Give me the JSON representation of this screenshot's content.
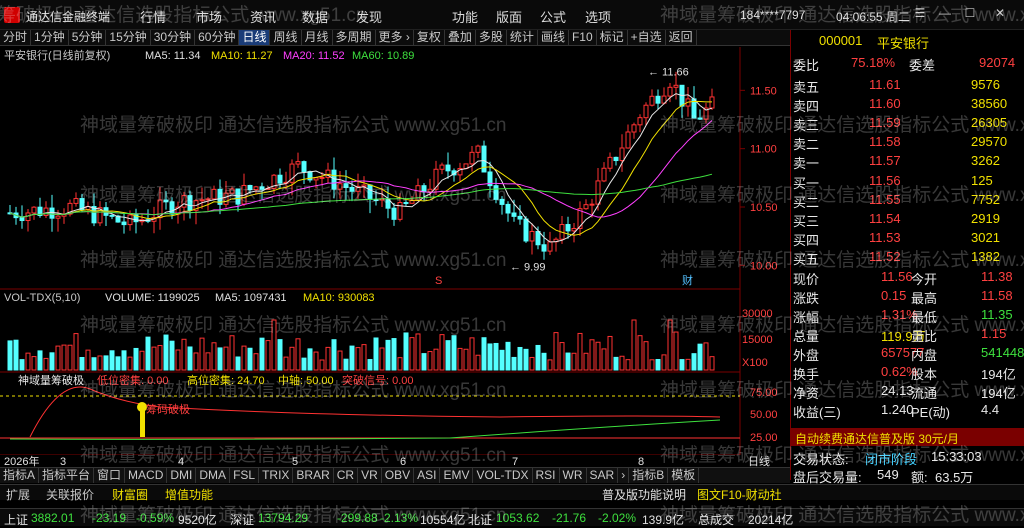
{
  "window": {
    "app_title": "通达信金融终端",
    "menus": [
      "行情",
      "市场",
      "资讯",
      "数据",
      "发现",
      "功能",
      "版面",
      "公式",
      "选项"
    ],
    "account": "184****7797",
    "clock": "04:06:55 周二"
  },
  "tabs": [
    "分时",
    "1分钟",
    "5分钟",
    "15分钟",
    "30分钟",
    "60分钟",
    "日线",
    "周线",
    "月线",
    "多周期",
    "更多 ›",
    "复权",
    "叠加",
    "多股",
    "统计",
    "画线",
    "F10",
    "标记",
    "+自选",
    "返回"
  ],
  "active_tab": "日线",
  "kline": {
    "header": "平安银行(日线前复权)",
    "ma5": "MA5: 11.34",
    "ma10": "MA10: 11.27",
    "ma20": "MA20: 11.52",
    "ma60": "MA60: 10.89",
    "axis": [
      "11.50",
      "11.00",
      "10.50",
      "10.00"
    ],
    "high_mark": "11.66",
    "low_mark": "9.99",
    "marker_s": "S",
    "marker_cai": "财"
  },
  "volume": {
    "header": "VOL-TDX(5,10)",
    "vol": "VOLUME: 1199025",
    "ma5": "MA5: 1097431",
    "ma10": "MA10: 930083",
    "axis": [
      "30000",
      "15000",
      "X100"
    ]
  },
  "indicator": {
    "header": "神域量筹破极",
    "t1": "低位密集: 0.00",
    "t2": "高位密集: 24.70",
    "t3": "中轴: 50.00",
    "t4": "突破信号: 0.00",
    "axis": [
      "75.00",
      "50.00",
      "25.00"
    ],
    "tag": "筹码破极"
  },
  "timeline": {
    "year": "2026年",
    "months": [
      "3",
      "4",
      "5",
      "6",
      "7",
      "8"
    ],
    "right": "日线"
  },
  "indicator_tabs": [
    "指标A",
    "指标平台",
    "窗口",
    "MACD",
    "DMI",
    "DMA",
    "FSL",
    "TRIX",
    "BRAR",
    "CR",
    "VR",
    "OBV",
    "ASI",
    "EMV",
    "VOL-TDX",
    "RSI",
    "WR",
    "SAR",
    "›",
    "指标B",
    "模板"
  ],
  "footer2": {
    "items": [
      "扩展",
      "关联报价",
      "财富圈",
      "增值功能"
    ],
    "news": "普及版功能说明",
    "extra": "图文F10-财动社"
  },
  "status": {
    "sh_label": "上证",
    "sh_val": "3882.01",
    "sh_chg": "-23.19",
    "sh_pct": "-0.59%",
    "sh_amt": "9520亿",
    "sz_label": "深证",
    "sz_val": "13794.29",
    "sz_chg": "-299.88",
    "sz_pct": "-2.13%",
    "sz_amt": "10554亿",
    "bz_label": "北证",
    "bz_val": "1053.62",
    "bz_chg": "-21.76",
    "bz_pct": "-2.02%",
    "bz_amt": "139.9亿",
    "total": "总成交",
    "total_val": "20214亿"
  },
  "stock": {
    "code": "000001",
    "name": "平安银行",
    "top_label": "委比",
    "top_pct": "75.18%",
    "top_diff_label": "委差",
    "top_diff": "92074",
    "asks": [
      {
        "l": "卖五",
        "p": "11.61",
        "v": "9576"
      },
      {
        "l": "卖四",
        "p": "11.60",
        "v": "38560"
      },
      {
        "l": "卖三",
        "p": "11.59",
        "v": "26305"
      },
      {
        "l": "卖二",
        "p": "11.58",
        "v": "29570"
      },
      {
        "l": "卖一",
        "p": "11.57",
        "v": "3262"
      }
    ],
    "bids": [
      {
        "l": "买一",
        "p": "11.56",
        "v": "125"
      },
      {
        "l": "买二",
        "p": "11.55",
        "v": "7752"
      },
      {
        "l": "买三",
        "p": "11.54",
        "v": "2919"
      },
      {
        "l": "买四",
        "p": "11.53",
        "v": "3021"
      },
      {
        "l": "买五",
        "p": "11.52",
        "v": "1382"
      }
    ],
    "stats": [
      {
        "a": "现价",
        "av": "11.56",
        "b": "今开",
        "bv": "11.38"
      },
      {
        "a": "涨跌",
        "av": "0.15",
        "b": "最高",
        "bv": "11.58"
      },
      {
        "a": "涨幅",
        "av": "1.31%",
        "b": "最低",
        "bv": "11.35"
      },
      {
        "a": "总量",
        "av": "119.9万",
        "b": "量比",
        "bv": "1.15"
      },
      {
        "a": "外盘",
        "av": "657577",
        "b": "内盘",
        "bv": "541448"
      },
      {
        "a": "换手",
        "av": "0.62%",
        "b": "股本",
        "bv": "194亿"
      },
      {
        "a": "净资",
        "av": "24.13",
        "b": "流通",
        "bv": "194亿"
      },
      {
        "a": "收益(三)",
        "av": "1.240",
        "b": "PE(动)",
        "bv": "4.4"
      }
    ],
    "ad": "自动续费通达信普及版 30元/月",
    "trade_status_label": "交易状态:",
    "trade_status": "闭市阶段",
    "trade_time": "15:33:03",
    "last_vol_label": "盘后交易量:",
    "last_vol": "549",
    "last_amt_label": "额:",
    "last_amt": "63.5万"
  },
  "watermark": "神域量筹破极印 通达信选股指标公式 www.xg51.cn",
  "chart_data": {
    "type": "candlestick",
    "title": "平安银行(日线前复权)",
    "ylim": [
      9.9,
      11.7
    ],
    "high": 11.66,
    "low": 9.99
  }
}
